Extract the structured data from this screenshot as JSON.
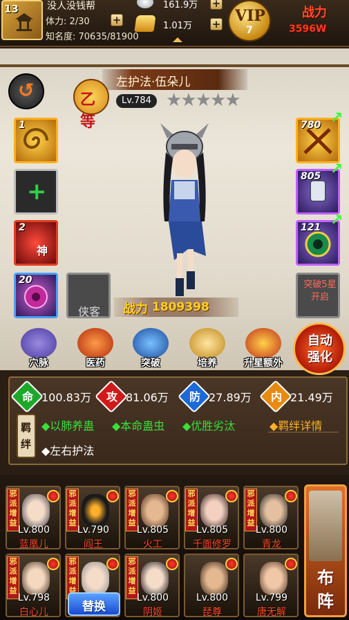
{
  "player": {
    "level": "13",
    "name": "没人没钱帮",
    "stamina": "体力: 2/30",
    "fame": "知名度: 70635/81900",
    "silver": "161.9万",
    "gold": "1.01万",
    "vip_label": "VIP",
    "vip_level": "7",
    "power_label": "战力",
    "power_value": "3596W"
  },
  "hero": {
    "rank": "乙等",
    "name": "左护法·伍朵儿",
    "level": "Lv.784",
    "stars": "★★★★★",
    "power_label": "战力",
    "power_value": "1809398"
  },
  "left_slots": [
    {
      "num": "1"
    },
    {
      "num": ""
    },
    {
      "num": "2",
      "char": "神"
    },
    {
      "num": "20"
    }
  ],
  "companion_slot": "侠客",
  "right_slots": [
    {
      "num": "780"
    },
    {
      "num": "805"
    },
    {
      "num": "121"
    }
  ],
  "breakthrough_hint": "突破5星开启",
  "functions": [
    {
      "label": "穴脉",
      "icon": "meridian-icon"
    },
    {
      "label": "医药",
      "icon": "medicine-icon"
    },
    {
      "label": "突破",
      "icon": "breakthrough-icon"
    },
    {
      "label": "培养",
      "icon": "train-icon"
    },
    {
      "label": "升星额外",
      "icon": "star-up-icon"
    }
  ],
  "auto_enhance": "自动强化",
  "stats": [
    {
      "icon": "命",
      "value": "100.83万",
      "color": "#1ea82a"
    },
    {
      "icon": "攻",
      "value": "81.06万",
      "color": "#d01a1a"
    },
    {
      "icon": "防",
      "value": "27.89万",
      "color": "#1a6ad8"
    },
    {
      "icon": "内",
      "value": "21.49万",
      "color": "#e88a10"
    }
  ],
  "bond_label": "羁绊",
  "bonds": [
    {
      "text": "◆以肺养蛊",
      "active": true
    },
    {
      "text": "◆本命蛊虫",
      "active": true
    },
    {
      "text": "◆优胜劣汰",
      "active": true
    },
    {
      "text": "◆左右护法",
      "active": false
    }
  ],
  "bond_detail": "◆羁绊详情",
  "team_ribbon": "邪派增益",
  "team": [
    {
      "level": "Lv.800",
      "name": "蓝凰儿"
    },
    {
      "level": "Lv.790",
      "name": "阎王"
    },
    {
      "level": "Lv.805",
      "name": "火工"
    },
    {
      "level": "Lv.805",
      "name": "千面修罗"
    },
    {
      "level": "Lv.800",
      "name": "青龙"
    },
    {
      "level": "Lv.798",
      "name": "白心儿"
    },
    {
      "level": "",
      "name": ""
    },
    {
      "level": "Lv.800",
      "name": "阴姬"
    },
    {
      "level": "Lv.800",
      "name": "琵尊"
    },
    {
      "level": "Lv.799",
      "name": "唐无解"
    }
  ],
  "swap_label": "替换",
  "formation_label": [
    "布",
    "阵"
  ],
  "colors": {
    "accent_gold": "#ffd21a",
    "bond_active": "#3adf3a",
    "bond_detail": "#ffb02a",
    "hero_name_red": "#ff4a2a"
  }
}
